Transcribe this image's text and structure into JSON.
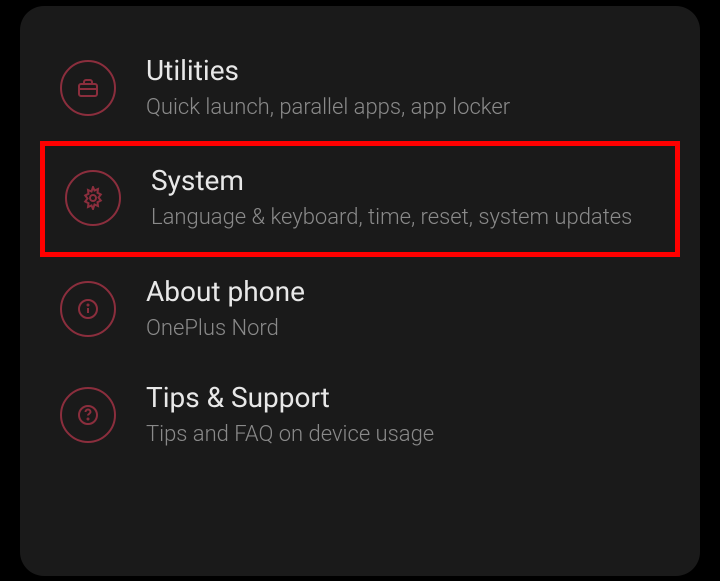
{
  "settings": {
    "items": [
      {
        "title": "Utilities",
        "subtitle": "Quick launch, parallel apps, app locker",
        "icon": "toolbox",
        "highlighted": false
      },
      {
        "title": "System",
        "subtitle": "Language & keyboard, time, reset, system updates",
        "icon": "gear",
        "highlighted": true
      },
      {
        "title": "About phone",
        "subtitle": "OnePlus Nord",
        "icon": "info",
        "highlighted": false
      },
      {
        "title": "Tips & Support",
        "subtitle": "Tips and FAQ on device usage",
        "icon": "help",
        "highlighted": false
      }
    ]
  },
  "colors": {
    "accent": "#8b2e3d",
    "highlight": "#ff0000",
    "background": "#1a1a1a",
    "titleText": "#e8e8e8",
    "subtitleText": "#8a8a8a"
  }
}
